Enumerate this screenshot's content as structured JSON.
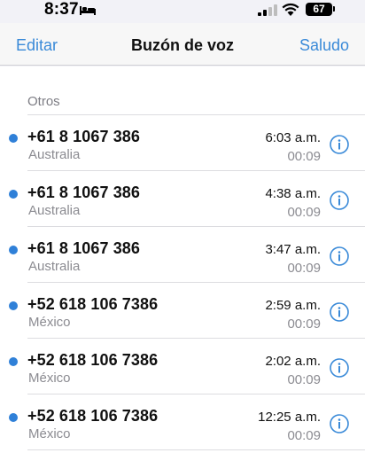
{
  "status_bar": {
    "time": "8:37",
    "battery": "67",
    "icons": [
      "bed-icon",
      "signal-icon",
      "wifi-icon",
      "battery-icon"
    ]
  },
  "nav": {
    "edit_label": "Editar",
    "title": "Buzón de voz",
    "greeting_label": "Saludo"
  },
  "section": {
    "header": "Otros"
  },
  "colors": {
    "accent": "#3a8ad8",
    "unread_dot": "#2f80d8",
    "secondary_text": "#8b8b91"
  },
  "voicemails": [
    {
      "number": "+61 8 1067 386",
      "country": "Australia",
      "time": "6:03 a.m.",
      "duration": "00:09",
      "unread": true
    },
    {
      "number": "+61 8 1067 386",
      "country": "Australia",
      "time": "4:38 a.m.",
      "duration": "00:09",
      "unread": true
    },
    {
      "number": "+61 8 1067 386",
      "country": "Australia",
      "time": "3:47 a.m.",
      "duration": "00:09",
      "unread": true
    },
    {
      "number": "+52 618 106 7386",
      "country": "México",
      "time": "2:59 a.m.",
      "duration": "00:09",
      "unread": true
    },
    {
      "number": "+52 618 106 7386",
      "country": "México",
      "time": "2:02 a.m.",
      "duration": "00:09",
      "unread": true
    },
    {
      "number": "+52 618 106 7386",
      "country": "México",
      "time": "12:25 a.m.",
      "duration": "00:09",
      "unread": true
    }
  ]
}
